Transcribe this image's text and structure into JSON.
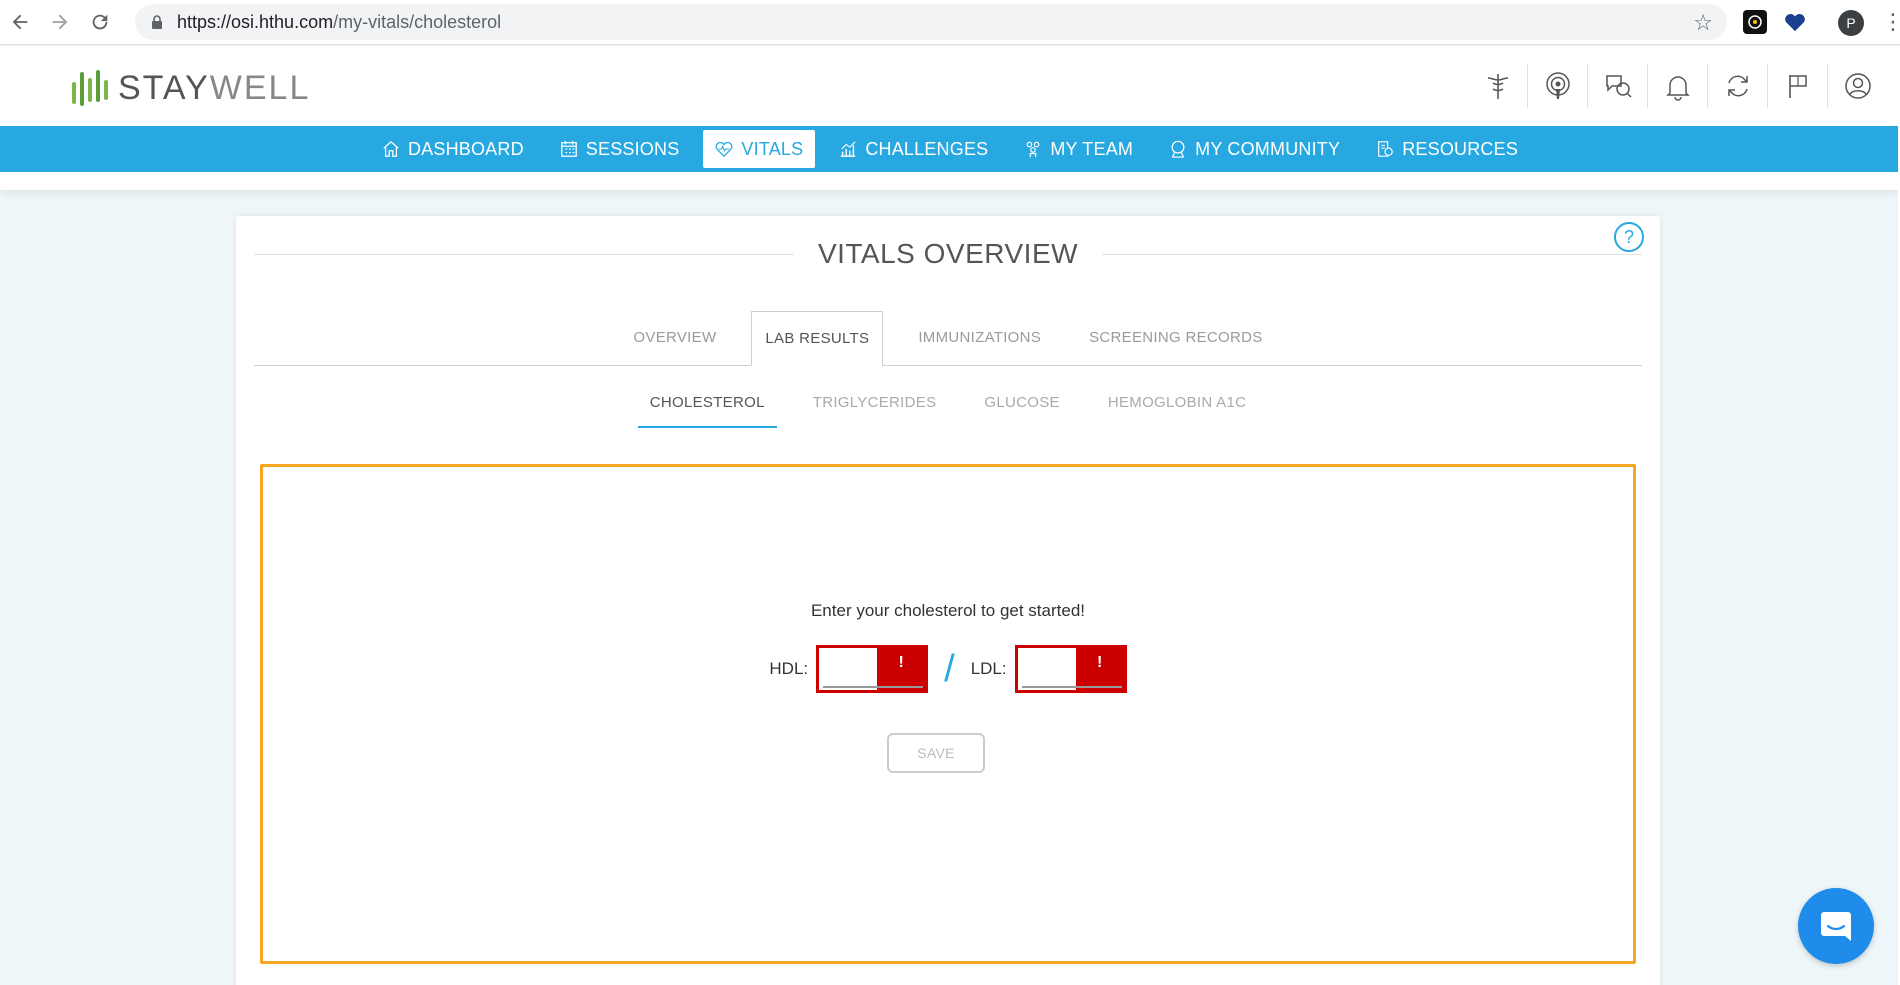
{
  "browser": {
    "url_host": "https://osi.hthu.com",
    "url_path": "/my-vitals/cholesterol",
    "profile_initial": "P"
  },
  "header": {
    "logo_text_bold": "STAY",
    "logo_text_light": "WELL",
    "icons": [
      "caduceus-icon",
      "podcast-icon",
      "chat-icon",
      "bell-icon",
      "sync-icon",
      "flag-icon",
      "user-icon"
    ]
  },
  "nav": {
    "items": [
      {
        "label": "DASHBOARD",
        "icon": "home-icon"
      },
      {
        "label": "SESSIONS",
        "icon": "calendar-icon"
      },
      {
        "label": "VITALS",
        "icon": "heart-icon",
        "active": true
      },
      {
        "label": "CHALLENGES",
        "icon": "chart-icon"
      },
      {
        "label": "MY TEAM",
        "icon": "team-icon"
      },
      {
        "label": "MY COMMUNITY",
        "icon": "community-icon"
      },
      {
        "label": "RESOURCES",
        "icon": "resources-icon"
      }
    ]
  },
  "card": {
    "title": "VITALS OVERVIEW",
    "help": "?",
    "tabs": [
      "OVERVIEW",
      "LAB RESULTS",
      "IMMUNIZATIONS",
      "SCREENING RECORDS"
    ],
    "active_tab": "LAB RESULTS",
    "subtabs": [
      "CHOLESTEROL",
      "TRIGLYCERIDES",
      "GLUCOSE",
      "HEMOGLOBIN A1C"
    ],
    "active_subtab": "CHOLESTEROL",
    "prompt": "Enter your cholesterol to get started!",
    "hdl_label": "HDL:",
    "ldl_label": "LDL:",
    "hdl_value": "",
    "ldl_value": "",
    "error_mark": "!",
    "slash": "/",
    "save_label": "SAVE"
  },
  "colors": {
    "brand_blue": "#27a8e0",
    "brand_green": "#7ab648",
    "error_red": "#cc0000",
    "highlight_orange": "#f5a623"
  }
}
